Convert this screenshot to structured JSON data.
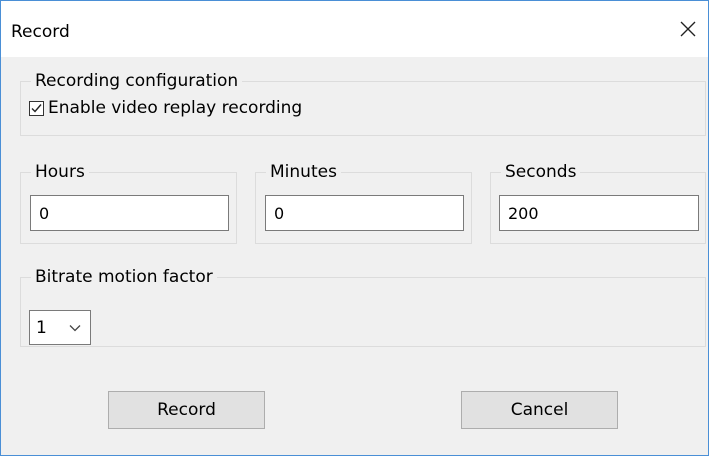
{
  "window": {
    "title": "Record",
    "close_icon": "close-icon"
  },
  "recording_config": {
    "group_label": "Recording configuration",
    "enable_label": "Enable video replay recording",
    "enable_checked": true
  },
  "duration": {
    "hours": {
      "label": "Hours",
      "value": "0"
    },
    "minutes": {
      "label": "Minutes",
      "value": "0"
    },
    "seconds": {
      "label": "Seconds",
      "value": "200"
    }
  },
  "bitrate": {
    "group_label": "Bitrate motion factor",
    "selected": "1"
  },
  "buttons": {
    "record": "Record",
    "cancel": "Cancel"
  },
  "colors": {
    "window_border": "#4a8fd6",
    "dialog_bg": "#f0f0f0",
    "button_bg": "#e1e1e1"
  }
}
